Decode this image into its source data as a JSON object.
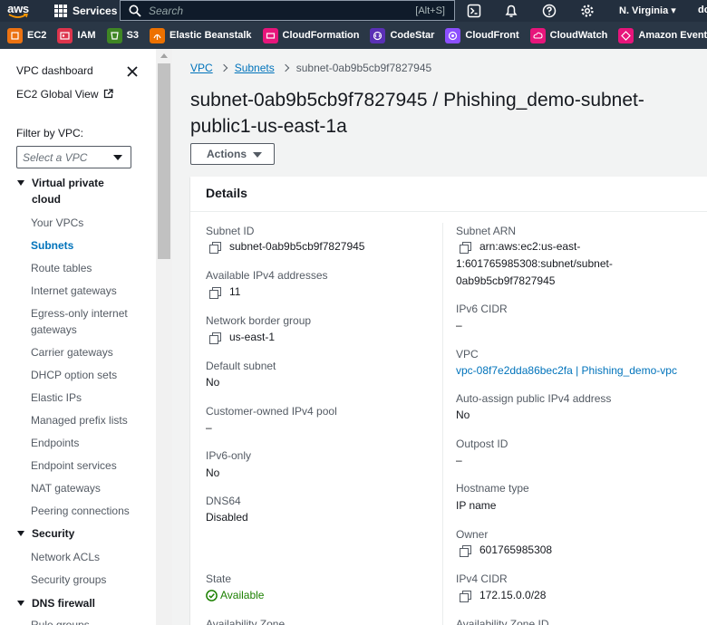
{
  "topnav": {
    "logo_text": "aws",
    "services_label": "Services",
    "search_placeholder": "Search",
    "search_shortcut": "[Alt+S]",
    "region": "N. Virginia",
    "account": "do"
  },
  "favorites": [
    {
      "label": "EC2",
      "color": "#ec7211",
      "icon": "ec2-icon"
    },
    {
      "label": "IAM",
      "color": "#dd344c",
      "icon": "iam-icon"
    },
    {
      "label": "S3",
      "color": "#3f8624",
      "icon": "s3-icon"
    },
    {
      "label": "Elastic Beanstalk",
      "color": "#ed7100",
      "icon": "beanstalk-icon"
    },
    {
      "label": "CloudFormation",
      "color": "#e7157b",
      "icon": "cloudformation-icon"
    },
    {
      "label": "CodeStar",
      "color": "#5a30b5",
      "icon": "codestar-icon"
    },
    {
      "label": "CloudFront",
      "color": "#8c4fff",
      "icon": "cloudfront-icon"
    },
    {
      "label": "CloudWatch",
      "color": "#e7157b",
      "icon": "cloudwatch-icon"
    },
    {
      "label": "Amazon EventBridge",
      "color": "#e7157b",
      "icon": "eventbridge-icon"
    }
  ],
  "sidebar": {
    "vpc_dashboard": "VPC dashboard",
    "ec2_global_view": "EC2 Global View",
    "filter_label": "Filter by VPC:",
    "filter_placeholder": "Select a VPC",
    "section_vpc": "Virtual private cloud",
    "vpc_items": [
      "Your VPCs",
      "Subnets",
      "Route tables",
      "Internet gateways",
      "Egress-only internet gateways",
      "Carrier gateways",
      "DHCP option sets",
      "Elastic IPs",
      "Managed prefix lists",
      "Endpoints",
      "Endpoint services",
      "NAT gateways",
      "Peering connections"
    ],
    "section_security": "Security",
    "security_items": [
      "Network ACLs",
      "Security groups"
    ],
    "section_dns": "DNS firewall",
    "dns_items": [
      "Rule groups"
    ]
  },
  "breadcrumb": {
    "vpc": "VPC",
    "subnets": "Subnets",
    "current": "subnet-0ab9b5cb9f7827945"
  },
  "page": {
    "title": "subnet-0ab9b5cb9f7827945 / Phishing_demo-subnet-public1-us-east-1a",
    "actions_label": "Actions"
  },
  "details": {
    "heading": "Details",
    "left": {
      "subnet_id_label": "Subnet ID",
      "subnet_id": "subnet-0ab9b5cb9f7827945",
      "avail_ipv4_label": "Available IPv4 addresses",
      "avail_ipv4": "11",
      "border_group_label": "Network border group",
      "border_group": "us-east-1",
      "default_subnet_label": "Default subnet",
      "default_subnet": "No",
      "customer_pool_label": "Customer-owned IPv4 pool",
      "customer_pool": "–",
      "ipv6_only_label": "IPv6-only",
      "ipv6_only": "No",
      "dns64_label": "DNS64",
      "dns64": "Disabled",
      "state_label": "State",
      "state": "Available",
      "az_label": "Availability Zone"
    },
    "right": {
      "arn_label": "Subnet ARN",
      "arn_line1": "arn:aws:ec2:us-east-",
      "arn_line2": "1:601765985308:subnet/subnet-",
      "arn_line3": "0ab9b5cb9f7827945",
      "ipv6_cidr_label": "IPv6 CIDR",
      "ipv6_cidr": "–",
      "vpc_label": "VPC",
      "vpc": "vpc-08f7e2dda86bec2fa | Phishing_demo-vpc",
      "auto_assign_label": "Auto-assign public IPv4 address",
      "auto_assign": "No",
      "outpost_label": "Outpost ID",
      "outpost": "–",
      "hostname_label": "Hostname type",
      "hostname": "IP name",
      "owner_label": "Owner",
      "owner": "601765985308",
      "ipv4_cidr_label": "IPv4 CIDR",
      "ipv4_cidr": "172.15.0.0/28",
      "az_id_label": "Availability Zone ID"
    }
  },
  "colors": {
    "nav_bg": "#232f3e",
    "fav_bg": "#2a3746",
    "link": "#0073bb",
    "success": "#1d8102",
    "aws_orange": "#ff9900"
  }
}
